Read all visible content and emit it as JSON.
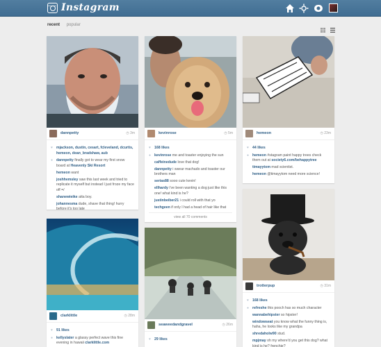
{
  "header": {
    "logo_text": "Instagram",
    "icons": [
      "home-icon",
      "news-icon",
      "profile-icon",
      "avatar"
    ]
  },
  "tabs": [
    {
      "label": "recent",
      "active": true
    },
    {
      "label": "popular",
      "active": false
    }
  ],
  "posts": [
    {
      "user": "dannpetty",
      "time": "3m",
      "likes": "mjackson, dustin, cesart, fcleveland, dcurtis, hemeon, dean_bradshaw, aub",
      "comments": [
        {
          "user": "dannpetty",
          "text": "finally got to wear my first snow board at ",
          "link": "Heavenly Ski Resort"
        },
        {
          "user": "hemeon",
          "text": "want"
        },
        {
          "user": "joshhemsley",
          "text": "saw this last week and tried to replicate it myself but instead I just froze my face off =/"
        },
        {
          "user": "shanewieike",
          "text": "atta boy."
        },
        {
          "user": "johannesma",
          "text": "dude, shave that thing! hurry before it's too late"
        }
      ]
    },
    {
      "user": "kevinrose",
      "time": "5m",
      "likes": "168 likes",
      "comments": [
        {
          "user": "kevinrose",
          "text": "me and toaster enjoying the sun"
        },
        {
          "user": "caffeinedude",
          "text": "love that dog!"
        },
        {
          "user": "dannpetty",
          "text": "i swear machado and toaster our brothers man"
        },
        {
          "user": "serias88",
          "text": "sooo cute kevin!"
        },
        {
          "user": "ellhardy",
          "text": "i've been wanting a dog just like this one! what kind is he?"
        },
        {
          "user": "justinbeiber21",
          "text": "i could roll with that yo"
        },
        {
          "user": "techgeen",
          "text": "if only I had a head of hair like that"
        }
      ],
      "view_all": "view all 70 comments"
    },
    {
      "user": "hemeon",
      "time": "23m",
      "likes": "44 likes",
      "comments": [
        {
          "user": "hemeon",
          "text": "#stagram paint happy trees check them out at ",
          "link": "society6.com/behappytree"
        },
        {
          "user": "timayytom",
          "text": "mad scientist."
        },
        {
          "user": "hemeon",
          "text": "@timayytom need more science!"
        }
      ]
    },
    {
      "user": "trotterpup",
      "time": "31m",
      "likes": "168 likes",
      "comments": [
        {
          "user": "refreshe",
          "text": "this pooch has so much character"
        },
        {
          "user": "wannabehipster",
          "text": "so hipster!"
        },
        {
          "user": "windowseat",
          "text": "you know what the funny thing is, haha, he looks like my grandpa"
        },
        {
          "user": "shredaholw90",
          "text": "stud."
        },
        {
          "user": "mpjmay",
          "text": "oh my where'd you get this dog? what kind is he? frenchie?"
        }
      ]
    },
    {
      "user": "clarklittle",
      "time": "28m",
      "likes": "91 likes",
      "comments": [
        {
          "user": "kellyslater",
          "text": "a glassy perfect wave this fine evening in hawaii ",
          "link": "clarklittle.com"
        }
      ]
    },
    {
      "user": "seaweedandgravel",
      "time": "26m",
      "likes": "29 likes",
      "comments": []
    }
  ]
}
